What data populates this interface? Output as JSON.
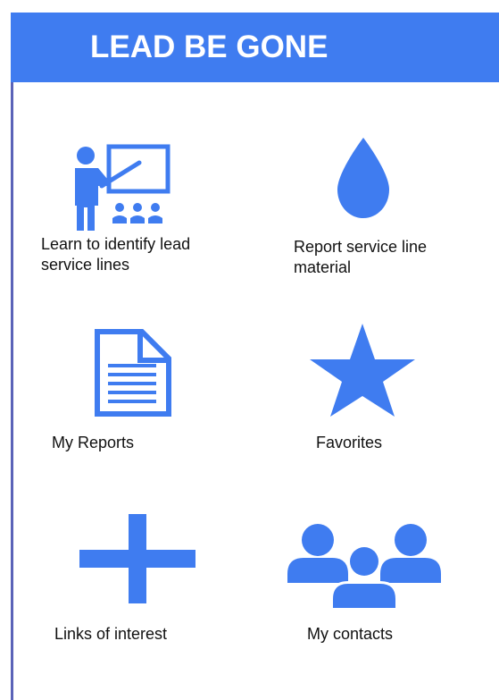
{
  "app": {
    "title": "LEAD BE GONE"
  },
  "colors": {
    "accent": "#3f7cf0",
    "rule": "#5b63b8",
    "text": "#111111"
  },
  "menu": {
    "items": [
      {
        "label": "Learn to identify lead service lines",
        "icon": "teacher-presentation-icon"
      },
      {
        "label": "Report service line material",
        "icon": "water-drop-icon"
      },
      {
        "label": "My Reports",
        "icon": "document-icon"
      },
      {
        "label": "Favorites",
        "icon": "star-icon"
      },
      {
        "label": "Links of interest",
        "icon": "plus-icon"
      },
      {
        "label": "My contacts",
        "icon": "group-icon"
      }
    ]
  }
}
